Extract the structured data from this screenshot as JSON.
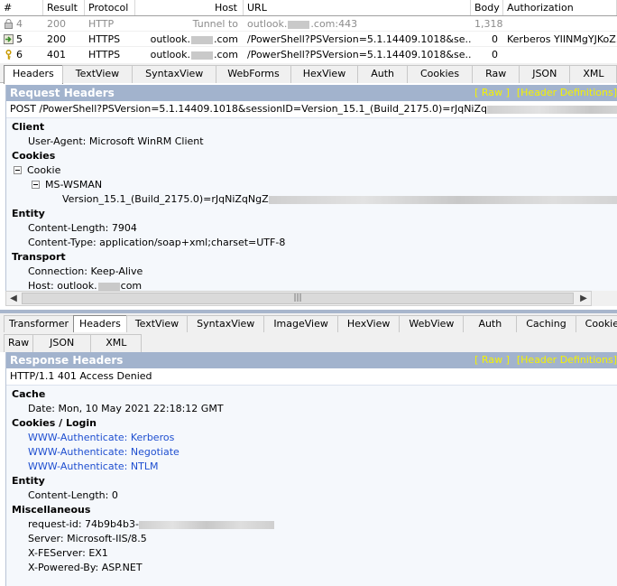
{
  "grid": {
    "columns": [
      "#",
      "Result",
      "Protocol",
      "Host",
      "URL",
      "Body",
      "Authorization"
    ],
    "rows": [
      {
        "num": "4",
        "result": "200",
        "protocol": "HTTP",
        "host": "Tunnel to",
        "url": "outlook.",
        "url_suffix": ".com:443",
        "body": "1,318",
        "auth": "",
        "icon": "lock-icon"
      },
      {
        "num": "5",
        "result": "200",
        "protocol": "HTTPS",
        "host": "outlook.",
        "host_suffix": ".com",
        "url": "/PowerShell?PSVersion=5.1.14409.1018&se...",
        "body": "0",
        "auth": "Kerberos YIINMgYJKoZ...",
        "icon": "arrow-icon"
      },
      {
        "num": "6",
        "result": "401",
        "protocol": "HTTPS",
        "host": "outlook.",
        "host_suffix": ".com",
        "url": "/PowerShell?PSVersion=5.1.14409.1018&se...",
        "body": "0",
        "auth": "",
        "icon": "key-icon"
      }
    ]
  },
  "request_tabs": [
    "Headers",
    "TextView",
    "SyntaxView",
    "WebForms",
    "HexView",
    "Auth",
    "Cookies",
    "Raw",
    "JSON",
    "XML"
  ],
  "request": {
    "title": "Request Headers",
    "raw_link": "[ Raw ]",
    "defs_link": "[Header Definitions]",
    "line": "POST /PowerShell?PSVersion=5.1.14409.1018&sessionID=Version_15.1_(Build_2175.0)=rJqNiZq",
    "client_group": "Client",
    "user_agent": "User-Agent: Microsoft WinRM Client",
    "cookies_group": "Cookies",
    "cookie_node": "Cookie",
    "mswsman_node": "MS-WSMAN",
    "mswsman_value": "Version_15.1_(Build_2175.0)=rJqNiZqNgZ",
    "entity_group": "Entity",
    "content_length": "Content-Length: 7904",
    "content_type": "Content-Type: application/soap+xml;charset=UTF-8",
    "transport_group": "Transport",
    "connection": "Connection: Keep-Alive",
    "host_prefix": "Host: outlook.",
    "host_suffix": "com"
  },
  "response_tabs_row1": [
    "Transformer",
    "Headers",
    "TextView",
    "SyntaxView",
    "ImageView",
    "HexView",
    "WebView",
    "Auth",
    "Caching",
    "Cookies"
  ],
  "response_tabs_row2": [
    "Raw",
    "JSON",
    "XML"
  ],
  "response": {
    "title": "Response Headers",
    "raw_link": "[ Raw ]",
    "defs_link": "[Header Definitions]",
    "status": "HTTP/1.1 401 Access Denied",
    "cache_group": "Cache",
    "date": "Date: Mon, 10 May 2021 22:18:12 GMT",
    "cookies_group": "Cookies / Login",
    "auth_kerberos": "WWW-Authenticate: Kerberos",
    "auth_negotiate": "WWW-Authenticate: Negotiate",
    "auth_ntlm": "WWW-Authenticate: NTLM",
    "entity_group": "Entity",
    "content_length": "Content-Length: 0",
    "misc_group": "Miscellaneous",
    "request_id": "request-id: 74b9b4b3-",
    "server": "Server: Microsoft-IIS/8.5",
    "fe_server": "X-FEServer: EX1",
    "powered_by": "X-Powered-By: ASP.NET"
  },
  "scrollbar_thumb_glyph": "|||"
}
